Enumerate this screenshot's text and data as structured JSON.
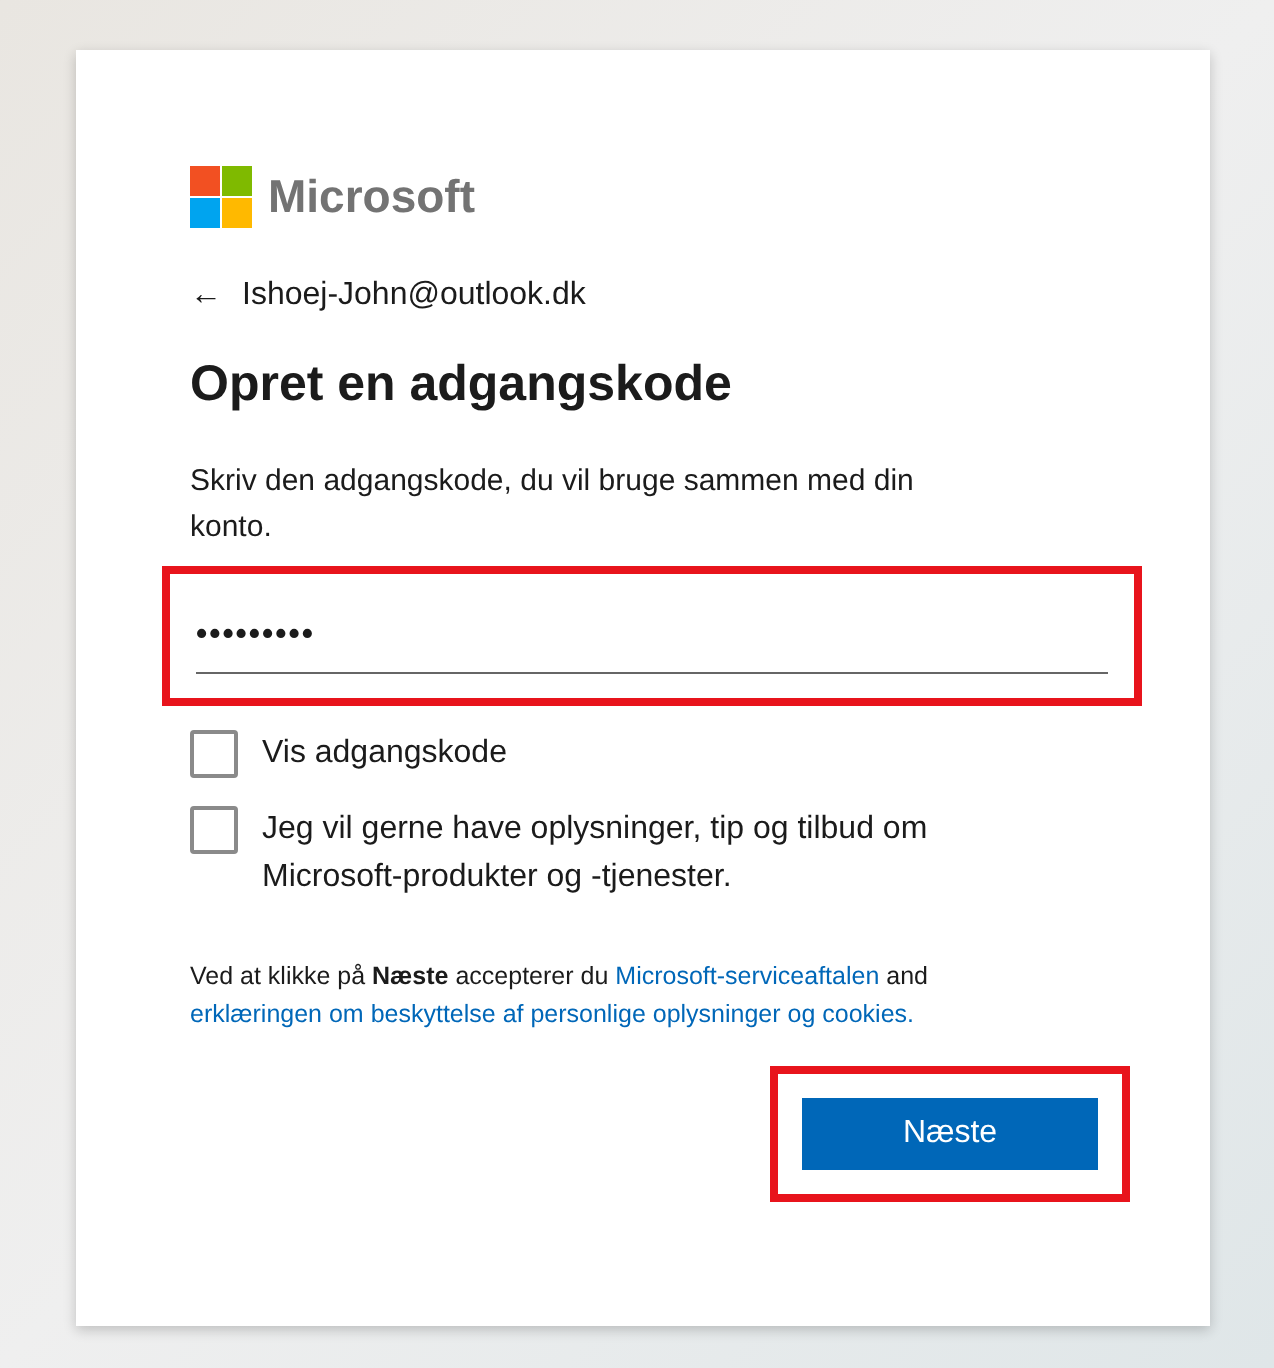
{
  "logo": {
    "text": "Microsoft"
  },
  "back": {
    "arrow": "←",
    "email": "Ishoej-John@outlook.dk"
  },
  "title": "Opret en adgangskode",
  "description": "Skriv den adgangskode, du vil bruge sammen med din konto.",
  "password_field": {
    "value": "•••••••••",
    "highlighted": true
  },
  "checkboxes": [
    {
      "label": "Vis adgangskode",
      "checked": false
    },
    {
      "label": "Jeg vil gerne have oplysninger, tip og tilbud om Microsoft-produkter og -tjenester.",
      "checked": false
    }
  ],
  "legal": {
    "text_1": "Ved at klikke på **Næste** accepterer du",
    "link_1": "Microsoft-serviceaftalen",
    "text_2": "and",
    "link_2": "erklæringen om beskyttelse af personlige oplysninger og cookies."
  },
  "next_button": {
    "label": "Næste",
    "highlighted": true
  }
}
